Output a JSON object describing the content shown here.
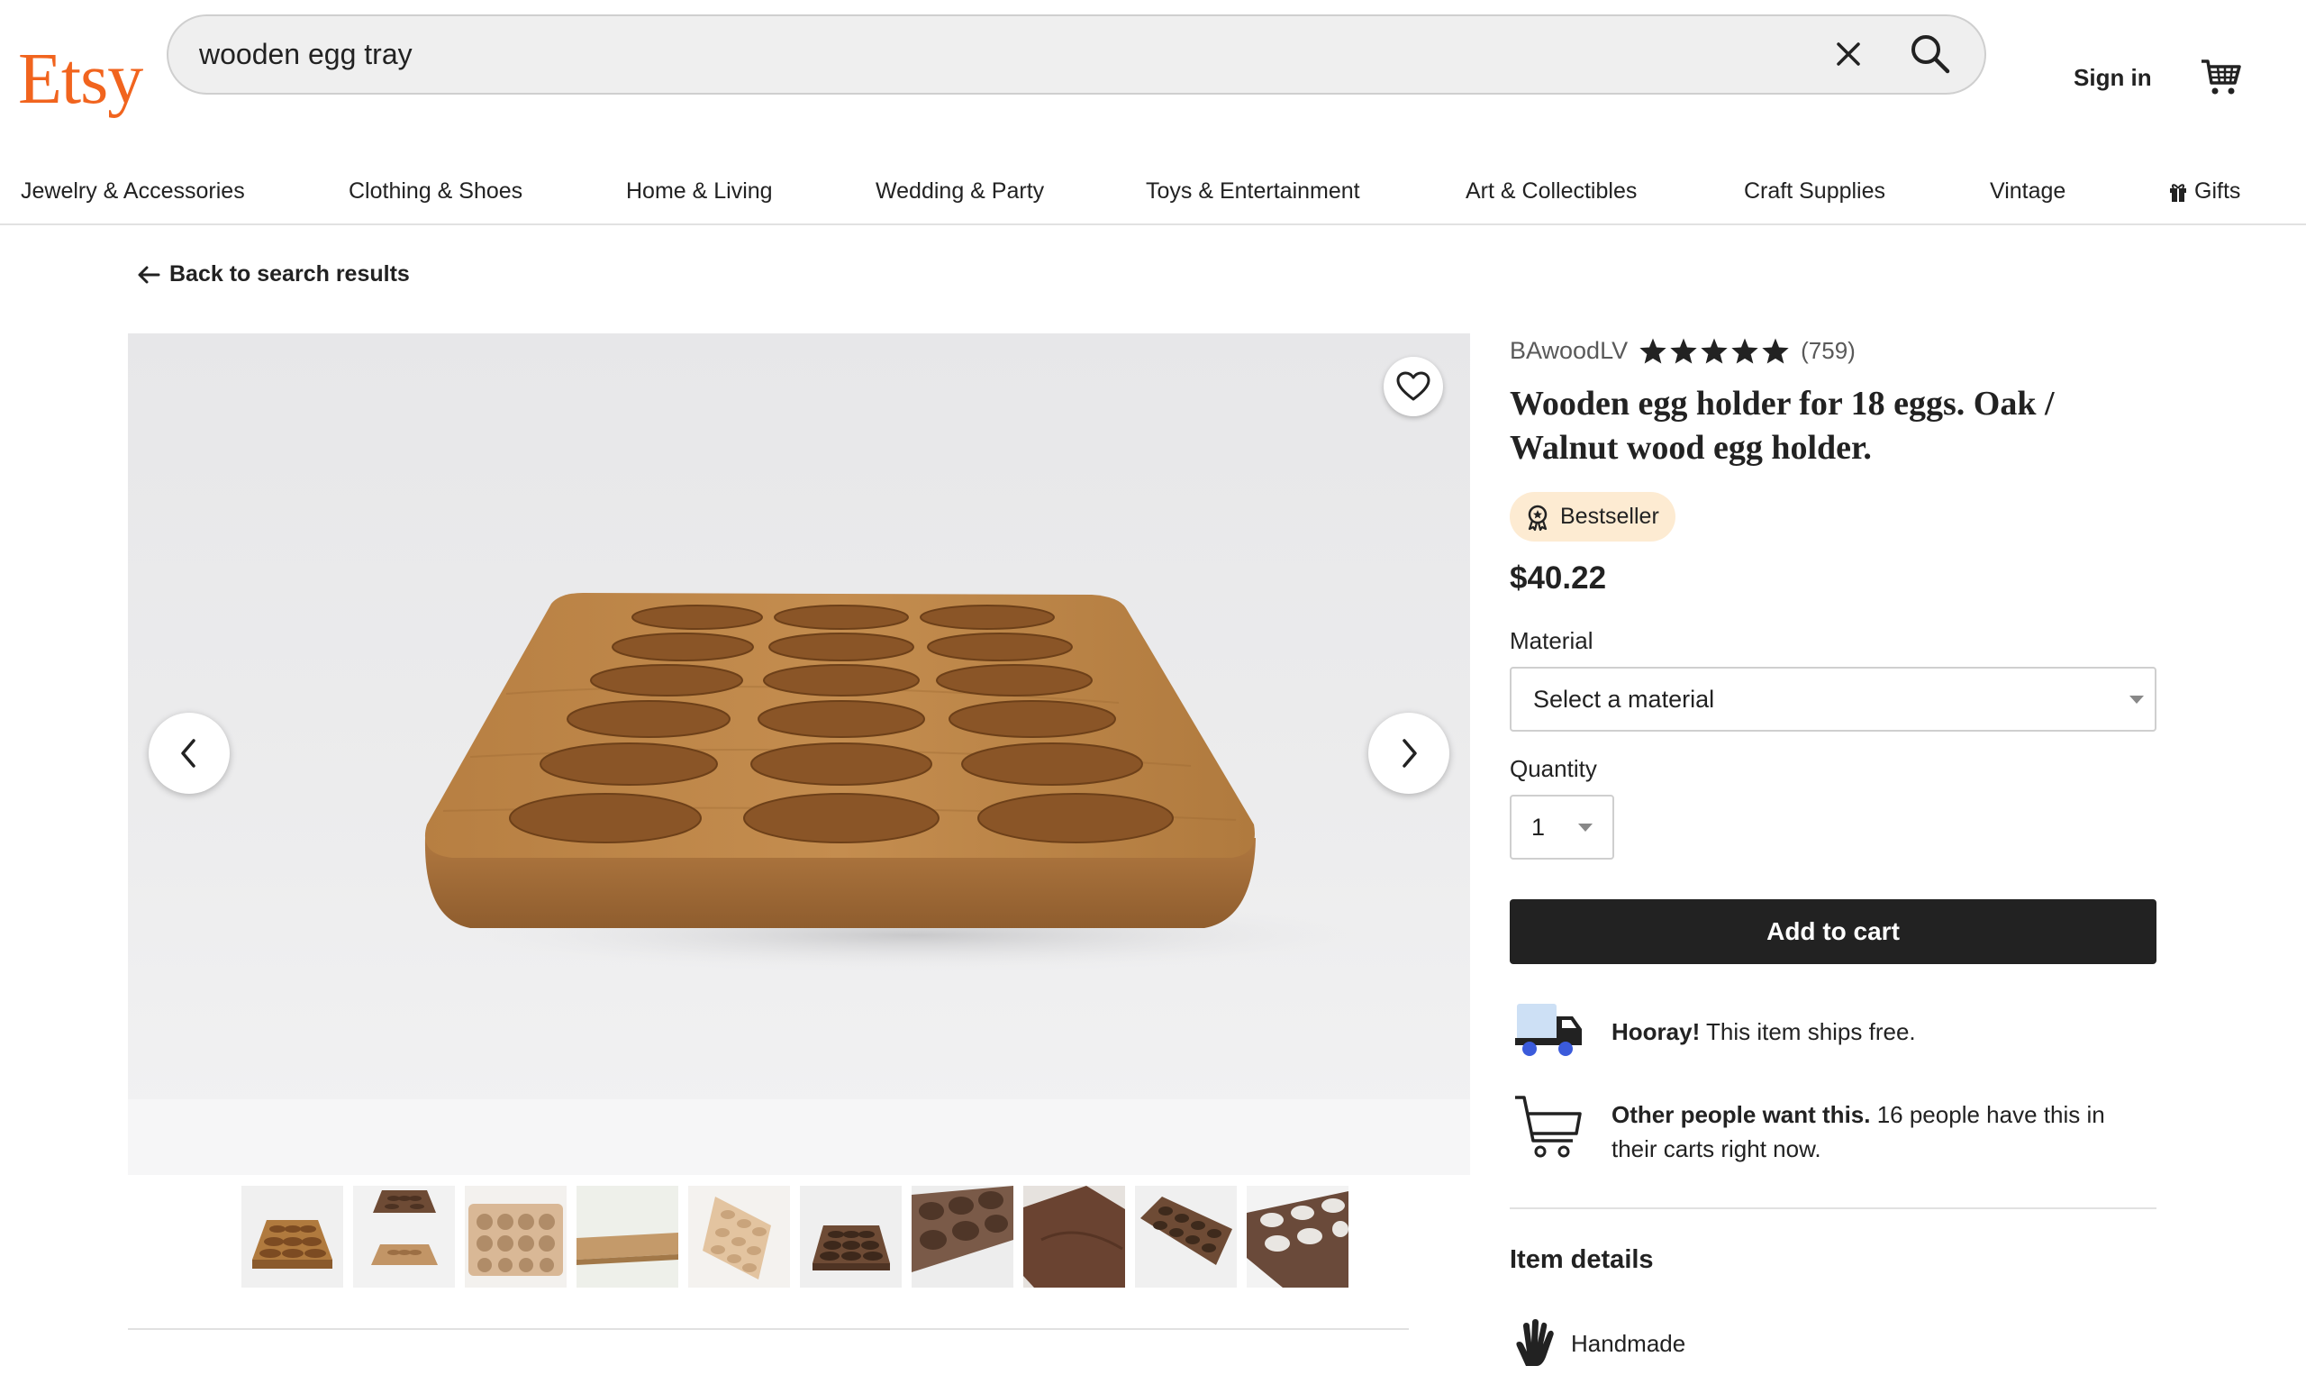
{
  "header": {
    "logo": "Etsy",
    "search_value": "wooden egg tray",
    "sign_in": "Sign in"
  },
  "nav": {
    "categories": [
      "Jewelry & Accessories",
      "Clothing & Shoes",
      "Home & Living",
      "Wedding & Party",
      "Toys & Entertainment",
      "Art & Collectibles",
      "Craft Supplies",
      "Vintage",
      "Gifts"
    ]
  },
  "back_link": "Back to search results",
  "listing": {
    "shop_name": "BAwoodLV",
    "rating": 5,
    "rating_count": "(759)",
    "title": "Wooden egg holder for 18 eggs. Oak / Walnut wood egg holder.",
    "badge": "Bestseller",
    "price": "$40.22",
    "material_label": "Material",
    "material_value": "Select a material",
    "quantity_label": "Quantity",
    "quantity_value": "1",
    "add_to_cart": "Add to cart",
    "shipping_bold": "Hooray!",
    "shipping_text": " This item ships free.",
    "demand_bold": "Other people want this.",
    "demand_text": " 16 people have this in their carts right now.",
    "details_heading": "Item details",
    "handmade": "Handmade",
    "thumbnail_count": 10
  },
  "colors": {
    "brand": "#F1641E",
    "button": "#222222",
    "badge_bg": "#FDEBD2",
    "oak": "#B07A3E",
    "walnut": "#6E4B35"
  },
  "icons": [
    "clear-icon",
    "search-icon",
    "cart-icon",
    "arrow-left-icon",
    "heart-icon",
    "chevron-left-icon",
    "chevron-right-icon",
    "star-icon",
    "bestseller-badge-icon",
    "truck-icon",
    "shopping-cart-outline-icon",
    "hand-icon",
    "gift-icon"
  ]
}
